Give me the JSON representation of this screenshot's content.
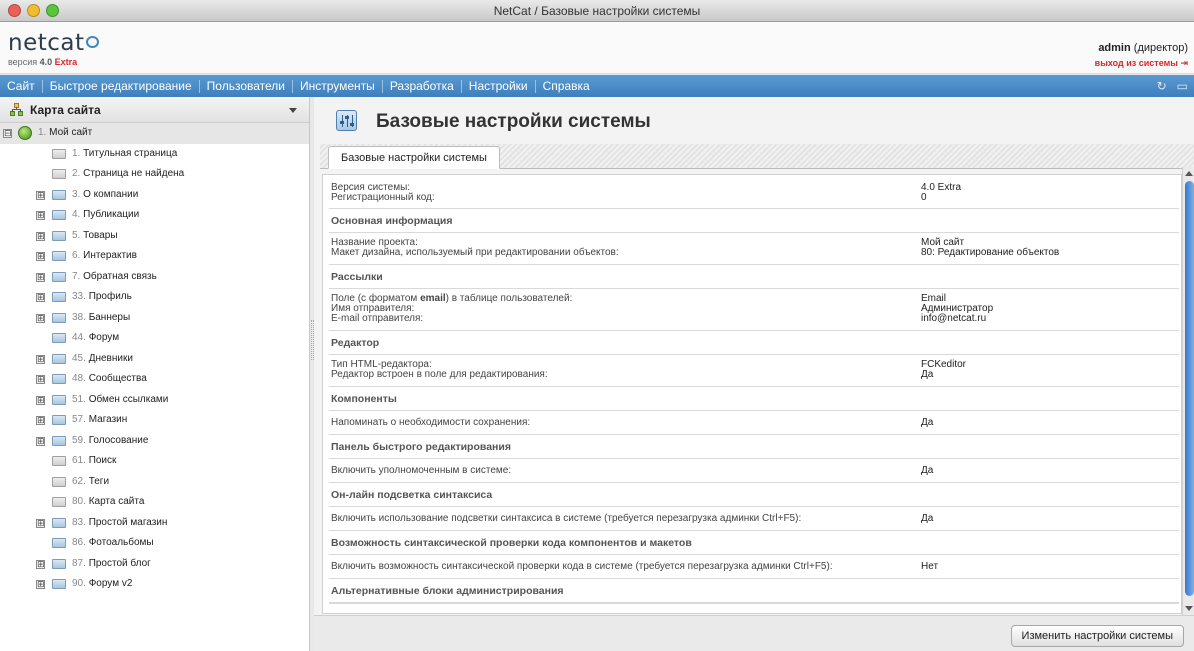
{
  "window": {
    "title": "NetCat / Базовые настройки системы"
  },
  "colors": {
    "accent": "#3d7fbd",
    "logout": "#d8262d"
  },
  "header": {
    "logo": "netcat",
    "version_prefix": "версия",
    "version_number": "4.0",
    "version_edition": "Extra",
    "user_name": "admin",
    "user_role": "(директор)",
    "logout": "выход из системы"
  },
  "menu": {
    "items": [
      "Сайт",
      "Быстрое редактирование",
      "Пользователи",
      "Инструменты",
      "Разработка",
      "Настройки",
      "Справка"
    ],
    "tool_icons": [
      "refresh-icon",
      "chat-icon"
    ]
  },
  "sidebar": {
    "title": "Карта сайта",
    "tree": [
      {
        "num": "1.",
        "label": "Мой сайт",
        "kind": "site",
        "expander": "⊟",
        "level": 0
      },
      {
        "num": "1.",
        "label": "Титульная страница",
        "kind": "page",
        "expander": "",
        "level": 1
      },
      {
        "num": "2.",
        "label": "Страница не найдена",
        "kind": "page",
        "expander": "",
        "level": 1
      },
      {
        "num": "3.",
        "label": "О компании",
        "kind": "folder",
        "expander": "⊞",
        "level": 1
      },
      {
        "num": "4.",
        "label": "Публикации",
        "kind": "folder",
        "expander": "⊞",
        "level": 1
      },
      {
        "num": "5.",
        "label": "Товары",
        "kind": "folder",
        "expander": "⊞",
        "level": 1
      },
      {
        "num": "6.",
        "label": "Интерактив",
        "kind": "folder",
        "expander": "⊞",
        "level": 1
      },
      {
        "num": "7.",
        "label": "Обратная связь",
        "kind": "folder",
        "expander": "⊞",
        "level": 1
      },
      {
        "num": "33.",
        "label": "Профиль",
        "kind": "folder",
        "expander": "⊞",
        "level": 1
      },
      {
        "num": "38.",
        "label": "Баннеры",
        "kind": "folder",
        "expander": "⊞",
        "level": 1
      },
      {
        "num": "44.",
        "label": "Форум",
        "kind": "folder",
        "expander": "",
        "level": 1
      },
      {
        "num": "45.",
        "label": "Дневники",
        "kind": "folder",
        "expander": "⊞",
        "level": 1
      },
      {
        "num": "48.",
        "label": "Сообщества",
        "kind": "folder",
        "expander": "⊞",
        "level": 1
      },
      {
        "num": "51.",
        "label": "Обмен ссылками",
        "kind": "folder",
        "expander": "⊞",
        "level": 1
      },
      {
        "num": "57.",
        "label": "Магазин",
        "kind": "folder",
        "expander": "⊞",
        "level": 1
      },
      {
        "num": "59.",
        "label": "Голосование",
        "kind": "folder",
        "expander": "⊞",
        "level": 1
      },
      {
        "num": "61.",
        "label": "Поиск",
        "kind": "page",
        "expander": "",
        "level": 1
      },
      {
        "num": "62.",
        "label": "Теги",
        "kind": "page",
        "expander": "",
        "level": 1
      },
      {
        "num": "80.",
        "label": "Карта сайта",
        "kind": "page",
        "expander": "",
        "level": 1
      },
      {
        "num": "83.",
        "label": "Простой магазин",
        "kind": "folder",
        "expander": "⊞",
        "level": 1
      },
      {
        "num": "86.",
        "label": "Фотоальбомы",
        "kind": "folder",
        "expander": "",
        "level": 1
      },
      {
        "num": "87.",
        "label": "Простой блог",
        "kind": "folder",
        "expander": "⊞",
        "level": 1
      },
      {
        "num": "90.",
        "label": "Форум v2",
        "kind": "folder",
        "expander": "⊞",
        "level": 1
      }
    ]
  },
  "main": {
    "title": "Базовые настройки системы",
    "tab": "Базовые настройки системы",
    "intro_rows": [
      {
        "key": "Версия системы:",
        "value": "4.0 Extra"
      },
      {
        "key": "Регистрационный код:",
        "value": "0"
      }
    ],
    "sections": [
      {
        "title": "Основная информация",
        "rows": [
          {
            "key": "Название проекта:",
            "value": "Мой сайт"
          },
          {
            "key": "Макет дизайна, используемый при редактировании объектов:",
            "value": "80: Редактирование объектов"
          }
        ]
      },
      {
        "title": "Рассылки",
        "rows": [
          {
            "key_before": "Поле (с форматом ",
            "key_bold": "email",
            "key_after": ") в таблице пользователей:",
            "value": "Email"
          },
          {
            "key": "Имя отправителя:",
            "value": "Администратор"
          },
          {
            "key": "E-mail отправителя:",
            "value": "info@netcat.ru"
          }
        ]
      },
      {
        "title": "Редактор",
        "rows": [
          {
            "key": "Тип HTML-редактора:",
            "value": "FCKeditor"
          },
          {
            "key": "Редактор встроен в поле для редактирования:",
            "value": "Да"
          }
        ]
      },
      {
        "title": "Компоненты",
        "rows": [
          {
            "key": "Напоминать о необходимости сохранения:",
            "value": "Да"
          }
        ]
      },
      {
        "title": "Панель быстрого редактирования",
        "rows": [
          {
            "key": "Включить уполномоченным в системе:",
            "value": "Да"
          }
        ]
      },
      {
        "title": "Он-лайн подсветка синтаксиса",
        "rows": [
          {
            "key": "Включить использование подсветки синтаксиса в системе (требуется перезагрузка админки Ctrl+F5):",
            "value": "Да"
          }
        ]
      },
      {
        "title": "Возможность синтаксической проверки кода компонентов и макетов",
        "rows": [
          {
            "key": "Включить возможность синтаксической проверки кода в системе (требуется перезагрузка админки Ctrl+F5):",
            "value": "Нет"
          }
        ]
      },
      {
        "title": "Альтернативные блоки администрирования",
        "rows": []
      }
    ],
    "save_button": "Изменить настройки системы"
  }
}
